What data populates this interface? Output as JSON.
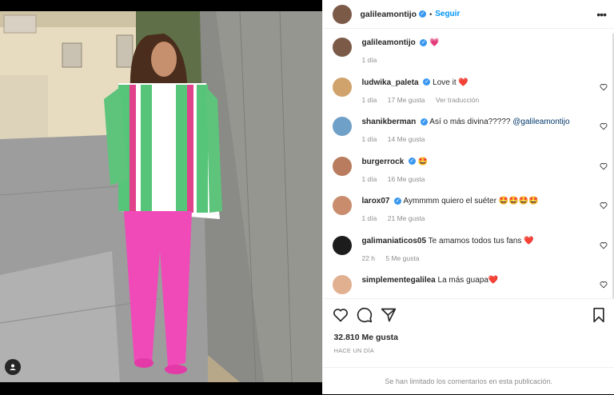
{
  "post": {
    "author": "galileamontijo",
    "follow_sep": "•",
    "follow_label": "Seguir",
    "more_label": "•••"
  },
  "caption": {
    "user": "galileamontijo",
    "text": "💗",
    "time": "1 día"
  },
  "comments": [
    {
      "user": "ludwika_paleta",
      "verified": true,
      "text": "Love it ❤️",
      "time": "1 día",
      "likes": "17 Me gusta",
      "extra": "Ver traducción",
      "avatar_color": "#d1a36c"
    },
    {
      "user": "shanikberman",
      "verified": true,
      "text": "Así o más divina?????",
      "mention": "@galileamontijo",
      "time": "1 día",
      "likes": "14 Me gusta",
      "extra": "",
      "avatar_color": "#6fa0c7"
    },
    {
      "user": "burgerrock",
      "verified": true,
      "text": "🤩",
      "time": "1 día",
      "likes": "16 Me gusta",
      "extra": "",
      "avatar_color": "#b97c5e"
    },
    {
      "user": "larox07",
      "verified": true,
      "text": "Aymmmm quiero el suéter 🤩🤩🤩🤩",
      "time": "1 día",
      "likes": "21 Me gusta",
      "extra": "",
      "avatar_color": "#c98d6e"
    },
    {
      "user": "galimaniaticos05",
      "verified": false,
      "text": "Te amamos todos tus fans ❤️",
      "time": "22 h",
      "likes": "5 Me gusta",
      "extra": "",
      "avatar_color": "#1c1c1c"
    },
    {
      "user": "simplementegalilea",
      "verified": false,
      "text": "La más guapa❤️",
      "time": "",
      "likes": "",
      "extra": "",
      "avatar_color": "#e1b090"
    }
  ],
  "likes_count": "32.810 Me gusta",
  "date_label": "HACE UN DÍA",
  "limited_comments": "Se han limitado los comentarios en esta publicación.",
  "colors": {
    "accent": "#0095f6",
    "verified": "#3897f0",
    "like": "#ed4956"
  }
}
